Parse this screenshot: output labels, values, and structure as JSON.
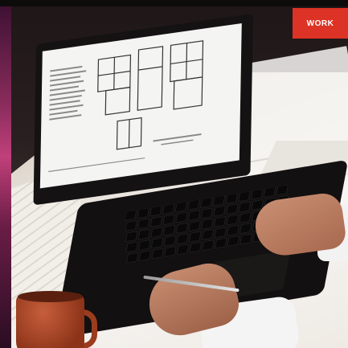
{
  "badge": {
    "label": "WORK",
    "color": "#dd3326"
  },
  "scene": {
    "subject": "laptop-on-architect-desk",
    "screen_content": "floor-plan-drawing"
  }
}
